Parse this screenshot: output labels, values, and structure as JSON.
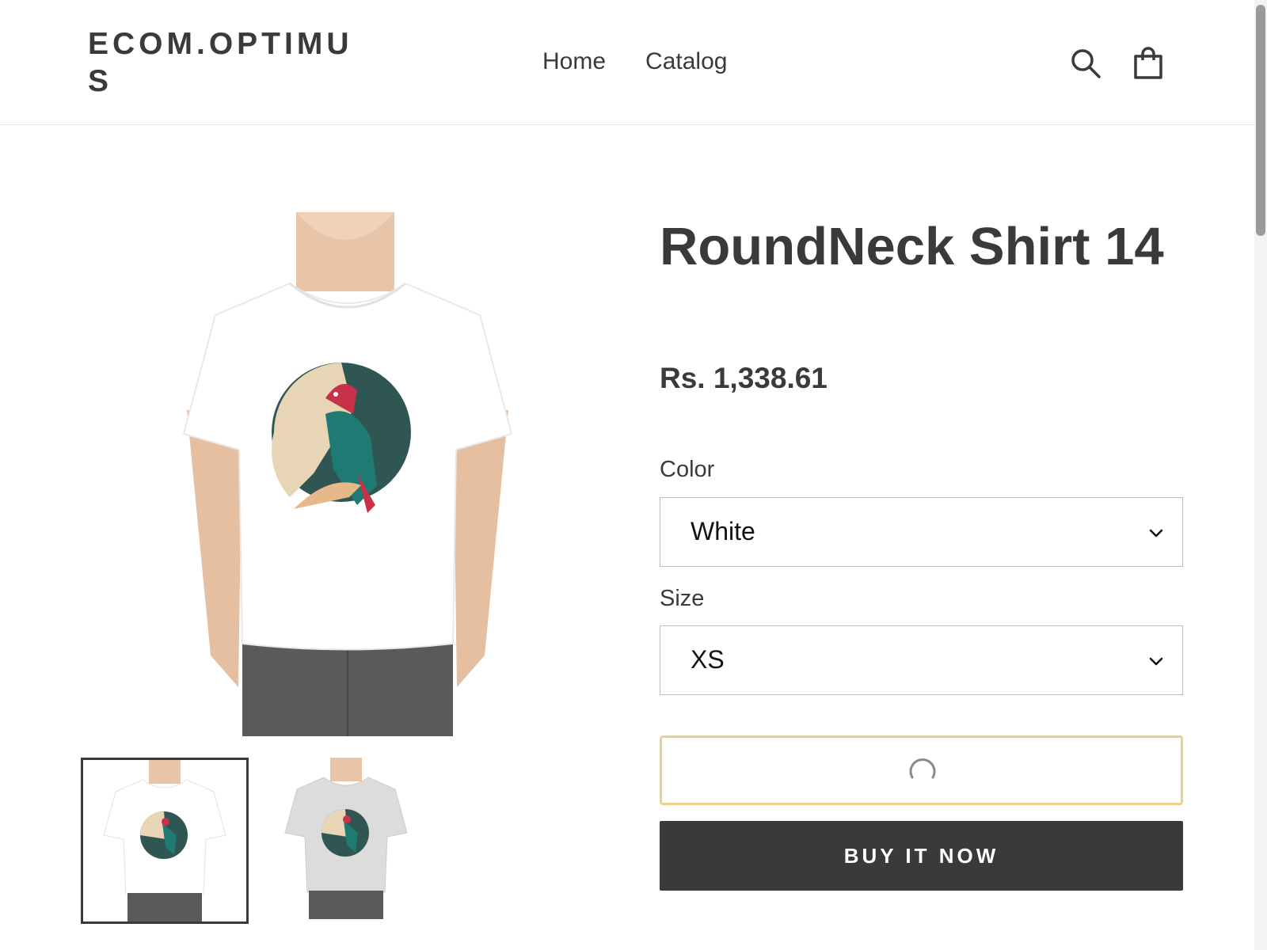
{
  "header": {
    "logo": "ECOM.OPTIMUS",
    "nav": [
      "Home",
      "Catalog"
    ],
    "icons": {
      "search": "search-icon",
      "cart": "cart-icon"
    }
  },
  "product": {
    "title": "RoundNeck Shirt 14",
    "price": "Rs. 1,338.61",
    "options": {
      "color": {
        "label": "Color",
        "value": "White"
      },
      "size": {
        "label": "Size",
        "value": "XS"
      }
    },
    "buy_now_label": "BUY IT NOW",
    "images": {
      "main": "white t-shirt with parrot print",
      "thumbnails": [
        "white t-shirt thumbnail",
        "light gray t-shirt thumbnail"
      ]
    }
  },
  "colors": {
    "text": "#3a3a3a",
    "accent_border": "#ecd18e",
    "buy_button": "#3a3a3a",
    "shirt_white": "#ffffff",
    "shirt_gray": "#dcdcdc"
  }
}
